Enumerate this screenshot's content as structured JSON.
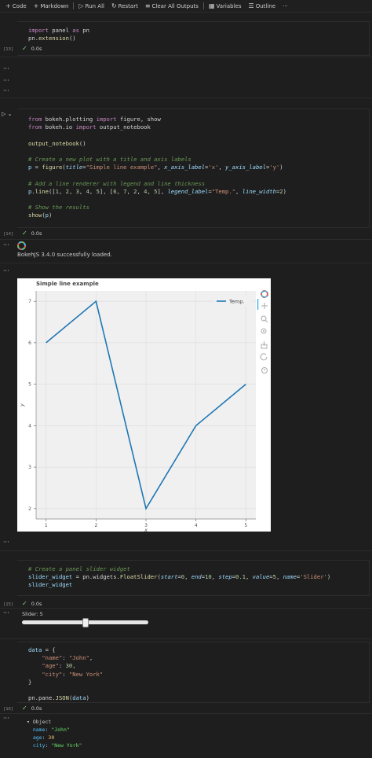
{
  "toolbar": {
    "code": "Code",
    "markdown": "Markdown",
    "run_all": "Run All",
    "restart": "Restart",
    "clear_all": "Clear All Outputs",
    "variables": "Variables",
    "outline": "Outline",
    "more": "···"
  },
  "cells": [
    {
      "exec_count": "[13]",
      "time": "0.0s",
      "code_lines": [
        "import panel as pn",
        "pn.extension()"
      ]
    },
    {
      "exec_count": "[14]",
      "time": "0.0s",
      "code_lines": [
        "from bokeh.plotting import figure, show",
        "from bokeh.io import output_notebook",
        "",
        "output_notebook()",
        "",
        "# Create a new plot with a title and axis labels",
        "p = figure(title=\"Simple line example\", x_axis_label='x', y_axis_label='y')",
        "",
        "# Add a line renderer with legend and line thickness",
        "p.line([1, 2, 3, 4, 5], [6, 7, 2, 4, 5], legend_label=\"Temp.\", line_width=2)",
        "",
        "# Show the results",
        "show(p)"
      ],
      "output_text": "BokehJS 3.4.0 successfully loaded."
    },
    {
      "exec_count": "[15]",
      "time": "0.0s",
      "code_lines": [
        "# Create a panel slider widget",
        "slider_widget = pn.widgets.FloatSlider(start=0, end=10, step=0.1, value=5, name='Slider')",
        "slider_widget"
      ]
    },
    {
      "exec_count": "[16]",
      "time": "0.0s",
      "code_lines": [
        "data = {",
        "    \"name\": \"John\",",
        "    \"age\": 30,",
        "    \"city\": \"New York\"",
        "}",
        "",
        "pn.pane.JSON(data)"
      ]
    }
  ],
  "chart_data": {
    "type": "line",
    "title": "Simple line example",
    "xlabel": "x",
    "ylabel": "y",
    "x": [
      1,
      2,
      3,
      4,
      5
    ],
    "series": [
      {
        "name": "Temp.",
        "values": [
          6,
          7,
          2,
          4,
          5
        ],
        "color": "#1f77b4"
      }
    ],
    "xlim": [
      0.8,
      5.2
    ],
    "ylim": [
      1.75,
      7.25
    ],
    "xticks": [
      "1",
      "2",
      "3",
      "4",
      "5"
    ],
    "yticks": [
      "2",
      "3",
      "4",
      "5",
      "6",
      "7"
    ],
    "grid": true,
    "legend": "top-right"
  },
  "slider": {
    "label": "Slider: 5",
    "start": 0,
    "end": 10,
    "value": 5
  },
  "json_view": {
    "root": "▾ Object",
    "entries": [
      {
        "key": "name",
        "value": "\"John\"",
        "kind": "string"
      },
      {
        "key": "age",
        "value": "30",
        "kind": "number"
      },
      {
        "key": "city",
        "value": "\"New York\"",
        "kind": "string"
      }
    ]
  },
  "colors": {
    "accent_check": "#89d185",
    "line": "#1f77b4"
  }
}
